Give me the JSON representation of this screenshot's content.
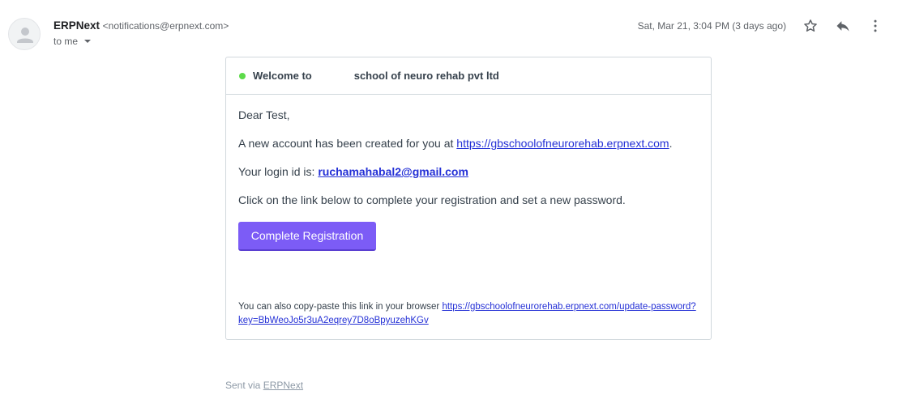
{
  "sender": {
    "name": "ERPNext",
    "email": "<notifications@erpnext.com>",
    "to_label": "to me"
  },
  "date": "Sat, Mar 21, 3:04 PM (3 days ago)",
  "icons": {
    "avatar": "person-icon",
    "star": "star-icon",
    "reply": "reply-icon",
    "more": "more-vert-icon",
    "status": "green-dot"
  },
  "card": {
    "title_prefix": "Welcome to",
    "title_suffix": "school of neuro rehab pvt ltd",
    "greeting": "Dear Test,",
    "account_text": "A new account has been created for you at ",
    "site_url": "https://gbschoolofneurorehab.erpnext.com",
    "account_end": ".",
    "login_prefix": "Your login id is: ",
    "login_id": "ruchamahabal2@gmail.com",
    "instruction": "Click on the link below to complete your registration and set a new password.",
    "button_label": "Complete Registration",
    "copy_text": "You can also copy-paste this link in your browser ",
    "copy_link": "https://gbschoolofneurorehab.erpnext.com/update-password?key=BbWeoJo5r3uA2eqrey7D8oBpyuzehKGv"
  },
  "footer": {
    "prefix": "Sent via ",
    "link": "ERPNext"
  },
  "colors": {
    "button": "#7c5cf6",
    "link": "#2430d6",
    "status_dot": "#5ddb4a"
  }
}
